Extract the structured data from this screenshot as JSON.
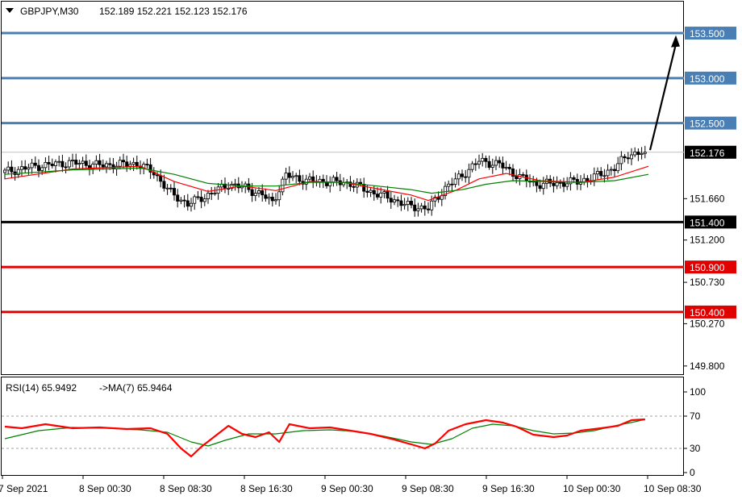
{
  "header": {
    "symbol_timeframe": "GBPJPY,M30",
    "ohlc": "152.189 152.221 152.123 152.176"
  },
  "rsi_header": {
    "label": "RSI(14) 65.9492",
    "ma_label": "->MA(7) 65.9464"
  },
  "chart_data": [
    {
      "type": "candlestick",
      "series": [
        {
          "kind": "candles"
        },
        {
          "kind": "moving_average",
          "color": "#ff0000"
        },
        {
          "kind": "moving_average",
          "color": "#008000"
        }
      ],
      "ylim": [
        149.7,
        153.85
      ],
      "price_ticks": [
        "151.660",
        "151.200",
        "150.730",
        "150.270",
        "149.800"
      ],
      "current_price": {
        "value": 152.176,
        "label": "152.176"
      },
      "horizontal_levels": [
        {
          "value": 153.5,
          "label": "153.500",
          "color": "#4a7fb5"
        },
        {
          "value": 153.0,
          "label": "153.000",
          "color": "#4a7fb5"
        },
        {
          "value": 152.5,
          "label": "152.500",
          "color": "#4a7fb5"
        },
        {
          "value": 151.4,
          "label": "151.400",
          "color": "#000000"
        },
        {
          "value": 150.9,
          "label": "150.900",
          "color": "#e00000"
        },
        {
          "value": 150.4,
          "label": "150.400",
          "color": "#e00000"
        }
      ],
      "arrow": {
        "from": 152.2,
        "to": 153.45,
        "direction": "up"
      },
      "x_labels": [
        "7 Sep 2021",
        "8 Sep 00:30",
        "8 Sep 08:30",
        "8 Sep 16:30",
        "9 Sep 00:30",
        "9 Sep 08:30",
        "9 Sep 16:30",
        "10 Sep 00:30",
        "10 Sep 08:30"
      ],
      "close_path": [
        [
          0,
          151.95
        ],
        [
          10,
          152.02
        ],
        [
          20,
          152.06
        ],
        [
          30,
          152.03
        ],
        [
          40,
          152.05
        ],
        [
          45,
          151.95
        ],
        [
          50,
          151.72
        ],
        [
          55,
          151.6
        ],
        [
          58,
          151.65
        ],
        [
          62,
          151.72
        ],
        [
          67,
          151.82
        ],
        [
          72,
          151.78
        ],
        [
          77,
          151.7
        ],
        [
          80,
          151.62
        ],
        [
          84,
          151.92
        ],
        [
          90,
          151.86
        ],
        [
          97,
          151.85
        ],
        [
          103,
          151.83
        ],
        [
          108,
          151.75
        ],
        [
          115,
          151.66
        ],
        [
          120,
          151.58
        ],
        [
          126,
          151.55
        ],
        [
          131,
          151.78
        ],
        [
          136,
          151.92
        ],
        [
          141,
          152.08
        ],
        [
          147,
          152.04
        ],
        [
          153,
          151.9
        ],
        [
          158,
          151.82
        ],
        [
          164,
          151.83
        ],
        [
          170,
          151.85
        ],
        [
          175,
          151.9
        ],
        [
          181,
          152.0
        ],
        [
          185,
          152.15
        ],
        [
          190,
          152.176
        ]
      ],
      "ma_red": [
        [
          0,
          151.88
        ],
        [
          20,
          151.99
        ],
        [
          40,
          152.02
        ],
        [
          50,
          151.85
        ],
        [
          60,
          151.74
        ],
        [
          70,
          151.8
        ],
        [
          80,
          151.75
        ],
        [
          90,
          151.85
        ],
        [
          100,
          151.84
        ],
        [
          110,
          151.77
        ],
        [
          120,
          151.7
        ],
        [
          125,
          151.64
        ],
        [
          133,
          151.75
        ],
        [
          140,
          151.88
        ],
        [
          148,
          151.94
        ],
        [
          158,
          151.86
        ],
        [
          170,
          151.84
        ],
        [
          180,
          151.9
        ],
        [
          190,
          152.02
        ]
      ],
      "ma_green": [
        [
          0,
          151.93
        ],
        [
          20,
          151.98
        ],
        [
          40,
          152.0
        ],
        [
          50,
          151.93
        ],
        [
          60,
          151.83
        ],
        [
          70,
          151.8
        ],
        [
          80,
          151.8
        ],
        [
          90,
          151.84
        ],
        [
          100,
          151.84
        ],
        [
          110,
          151.8
        ],
        [
          120,
          151.76
        ],
        [
          126,
          151.72
        ],
        [
          135,
          151.76
        ],
        [
          142,
          151.82
        ],
        [
          150,
          151.86
        ],
        [
          160,
          151.85
        ],
        [
          170,
          151.84
        ],
        [
          180,
          151.86
        ],
        [
          190,
          151.93
        ]
      ]
    },
    {
      "type": "line",
      "ylim": [
        0,
        100
      ],
      "y_ticks": [
        100,
        70,
        30,
        0
      ],
      "levels": [
        70,
        30
      ],
      "series": [
        {
          "color": "#ff0000",
          "values": [
            [
              0,
              57
            ],
            [
              5,
              55
            ],
            [
              12,
              60
            ],
            [
              20,
              55
            ],
            [
              28,
              56
            ],
            [
              36,
              54
            ],
            [
              43,
              55
            ],
            [
              48,
              48
            ],
            [
              52,
              30
            ],
            [
              55,
              20
            ],
            [
              58,
              32
            ],
            [
              62,
              45
            ],
            [
              66,
              58
            ],
            [
              70,
              48
            ],
            [
              74,
              44
            ],
            [
              78,
              50
            ],
            [
              81,
              38
            ],
            [
              84,
              60
            ],
            [
              90,
              55
            ],
            [
              96,
              56
            ],
            [
              102,
              52
            ],
            [
              108,
              48
            ],
            [
              114,
              42
            ],
            [
              120,
              35
            ],
            [
              124,
              30
            ],
            [
              127,
              36
            ],
            [
              131,
              52
            ],
            [
              136,
              60
            ],
            [
              142,
              65
            ],
            [
              147,
              62
            ],
            [
              151,
              57
            ],
            [
              156,
              47
            ],
            [
              162,
              44
            ],
            [
              166,
              46
            ],
            [
              170,
              52
            ],
            [
              176,
              55
            ],
            [
              181,
              58
            ],
            [
              185,
              65
            ],
            [
              189,
              66
            ]
          ]
        },
        {
          "color": "#008000",
          "values": [
            [
              0,
              42
            ],
            [
              10,
              52
            ],
            [
              20,
              56
            ],
            [
              30,
              55
            ],
            [
              40,
              53
            ],
            [
              48,
              50
            ],
            [
              55,
              38
            ],
            [
              60,
              33
            ],
            [
              65,
              40
            ],
            [
              72,
              48
            ],
            [
              80,
              48
            ],
            [
              88,
              52
            ],
            [
              96,
              53
            ],
            [
              104,
              51
            ],
            [
              112,
              45
            ],
            [
              120,
              38
            ],
            [
              126,
              35
            ],
            [
              132,
              42
            ],
            [
              138,
              55
            ],
            [
              144,
              60
            ],
            [
              150,
              58
            ],
            [
              156,
              52
            ],
            [
              162,
              48
            ],
            [
              168,
              49
            ],
            [
              174,
              52
            ],
            [
              180,
              58
            ],
            [
              186,
              63
            ],
            [
              189,
              66
            ]
          ]
        }
      ]
    }
  ]
}
